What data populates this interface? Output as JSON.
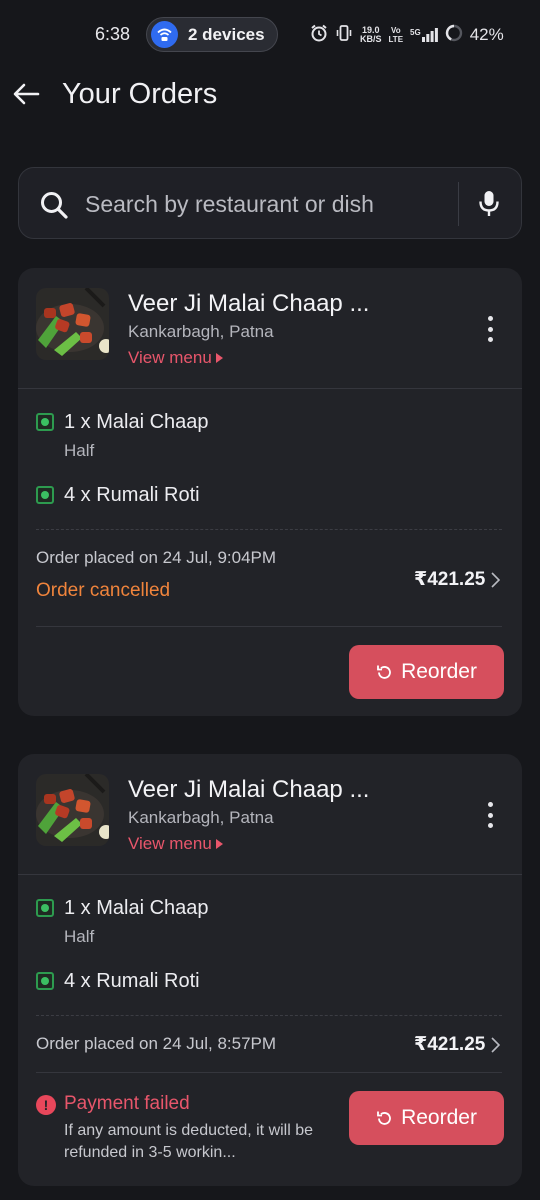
{
  "status_bar": {
    "time": "6:38",
    "devices_label": "2 devices",
    "speed_value": "19.0",
    "speed_unit": "KB/S",
    "volte_top": "Vo",
    "volte_bottom": "LTE",
    "network": "5G",
    "battery": "42%"
  },
  "header": {
    "title": "Your Orders"
  },
  "search": {
    "placeholder": "Search by restaurant or dish",
    "value": ""
  },
  "orders": [
    {
      "restaurant": "Veer Ji Malai Chaap ...",
      "location": "Kankarbagh, Patna",
      "view_menu": "View menu",
      "items": [
        {
          "text": "1 x Malai Chaap",
          "variant": "Half"
        },
        {
          "text": "4 x Rumali Roti"
        }
      ],
      "placed": "Order placed on 24 Jul, 9:04PM",
      "status": "Order cancelled",
      "price": "₹421.25",
      "reorder": "Reorder"
    },
    {
      "restaurant": "Veer Ji Malai Chaap ...",
      "location": "Kankarbagh, Patna",
      "view_menu": "View menu",
      "items": [
        {
          "text": "1 x Malai Chaap",
          "variant": "Half"
        },
        {
          "text": "4 x Rumali Roti"
        }
      ],
      "placed": "Order placed on 24 Jul, 8:57PM",
      "price": "₹421.25",
      "payment_title": "Payment failed",
      "payment_desc": "If any amount is deducted, it will be refunded in 3-5 workin...",
      "reorder": "Reorder"
    }
  ],
  "colors": {
    "accent": "#d64f5d",
    "cancel": "#f0843c",
    "link": "#e8566b",
    "veg": "#2d9b4f"
  }
}
